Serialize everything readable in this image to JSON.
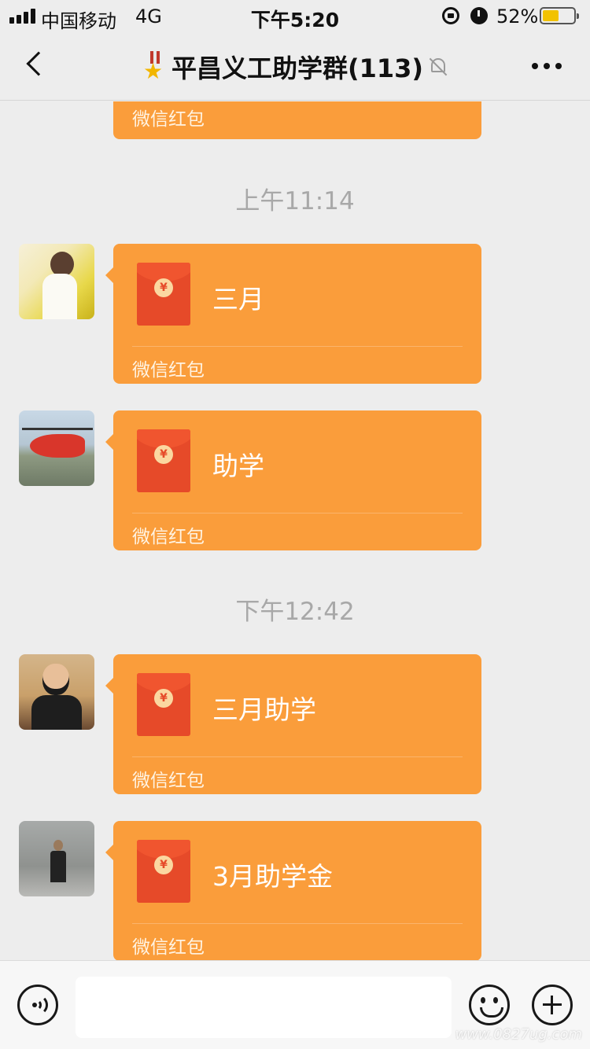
{
  "status_bar": {
    "carrier": "中国移动",
    "network": "4G",
    "time": "下午5:20",
    "battery_percent": "52%",
    "battery_level": 0.52,
    "icons": [
      "signal-icon",
      "rotation-lock-icon",
      "alarm-icon",
      "battery-icon"
    ]
  },
  "nav": {
    "title": "平昌义工助学群(113)",
    "icons": [
      "back-icon",
      "medal-icon",
      "mute-icon",
      "more-icon"
    ]
  },
  "chat": {
    "top_partial_footer": "微信红包",
    "timestamps": [
      "上午11:14",
      "下午12:42"
    ],
    "messages": [
      {
        "title": "三月",
        "footer": "微信红包"
      },
      {
        "title": "助学",
        "footer": "微信红包"
      },
      {
        "title": "三月助学",
        "footer": "微信红包"
      },
      {
        "title": "3月助学金",
        "footer": "微信红包"
      }
    ],
    "bubble_color": "#fa9d3b",
    "packet_color": "#e64a29"
  },
  "input_bar": {
    "text_value": "",
    "icons": [
      "voice-icon",
      "emoji-icon",
      "plus-icon"
    ],
    "watermark": "www.0827ug.com"
  }
}
